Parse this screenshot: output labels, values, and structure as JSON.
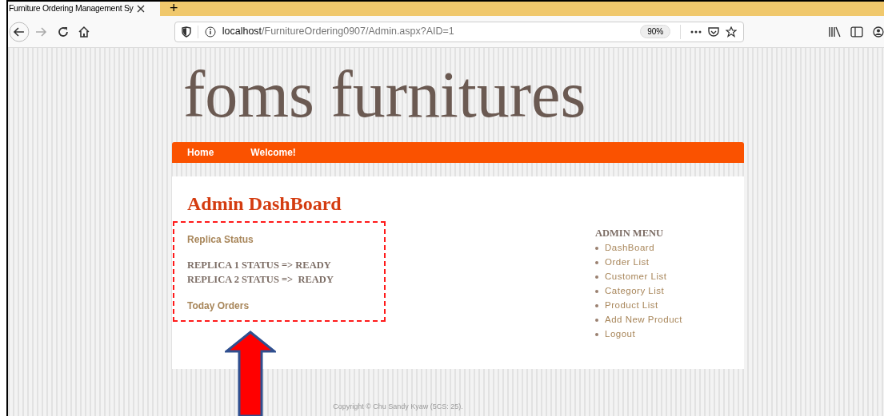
{
  "browser": {
    "tab_title": "Furniture Ordering Management Sy",
    "new_tab": "+",
    "url_host": "localhost",
    "url_path": "/FurnitureOrdering0907/Admin.aspx?AID=1",
    "zoom": "90%"
  },
  "site": {
    "logo": "foms furnitures",
    "nav": [
      {
        "label": "Home"
      },
      {
        "label": "Welcome!"
      }
    ],
    "heading": "Admin DashBoard",
    "replica_title": "Replica Status",
    "replicas": [
      "REPLICA 1 STATUS => READY",
      "REPLICA 2 STATUS =>  READY"
    ],
    "today_orders": "Today Orders",
    "menu_title": "ADMIN MENU",
    "menu": [
      "DashBoard",
      "Order List",
      "Customer List",
      "Category List",
      "Product List",
      "Add New Product",
      "Logout"
    ],
    "footer": "Copyright © Chu Sandy Kyaw (5CS: 25)."
  }
}
